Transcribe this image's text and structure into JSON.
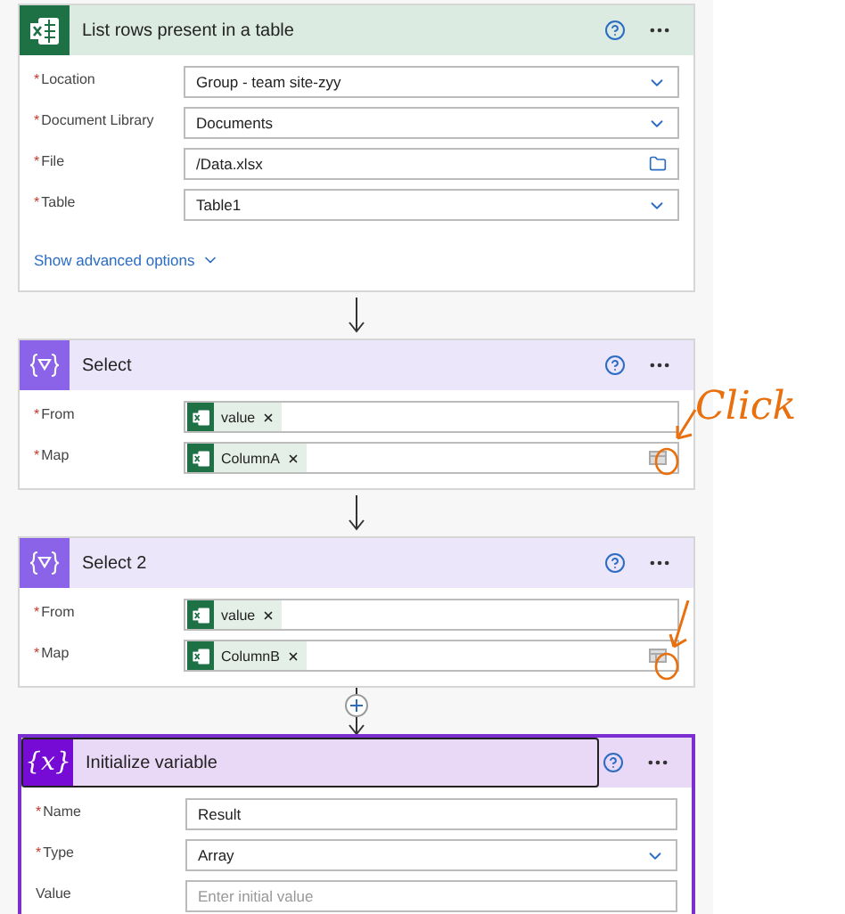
{
  "cards": [
    {
      "kind": "excel",
      "title": "List rows present in a table",
      "selected": false,
      "advanced": "Show advanced options",
      "fields": [
        {
          "label": "Location",
          "marker": "*",
          "kind": "dropdown",
          "value": "Group - team site-zyy"
        },
        {
          "label": "Document Library",
          "marker": "*",
          "kind": "dropdown",
          "value": "Documents"
        },
        {
          "label": "File",
          "marker": "*",
          "kind": "file",
          "value": "/Data.xlsx"
        },
        {
          "label": "Table",
          "marker": "*",
          "kind": "dropdown",
          "value": "Table1"
        }
      ]
    },
    {
      "kind": "select",
      "title": "Select",
      "selected": false,
      "connector": {
        "kind": "arrow"
      },
      "fields": [
        {
          "label": "From",
          "marker": "*",
          "kind": "tokens",
          "tokens": [
            "value"
          ]
        },
        {
          "label": "Map",
          "marker": "*",
          "kind": "tokens",
          "tokens": [
            "ColumnA"
          ],
          "switch_mode": true,
          "annotation": {
            "kind": "arrow-note",
            "text": "Click"
          }
        }
      ]
    },
    {
      "kind": "select",
      "title": "Select 2",
      "selected": false,
      "connector": {
        "kind": "arrow"
      },
      "fields": [
        {
          "label": "From",
          "marker": "*",
          "kind": "tokens",
          "tokens": [
            "value"
          ]
        },
        {
          "label": "Map",
          "marker": "*",
          "kind": "tokens",
          "tokens": [
            "ColumnB"
          ],
          "switch_mode": true,
          "annotation": {
            "kind": "arrow"
          }
        }
      ]
    },
    {
      "kind": "variable",
      "title": "Initialize variable",
      "glyph": "{x}",
      "selected": true,
      "connector": {
        "kind": "plus"
      },
      "fields": [
        {
          "label": "Name",
          "marker": "*",
          "kind": "text",
          "value": "Result"
        },
        {
          "label": "Type",
          "marker": "*",
          "kind": "dropdown",
          "value": "Array"
        },
        {
          "label": "Value",
          "kind": "text",
          "placeholder": "Enter initial value"
        }
      ]
    }
  ]
}
